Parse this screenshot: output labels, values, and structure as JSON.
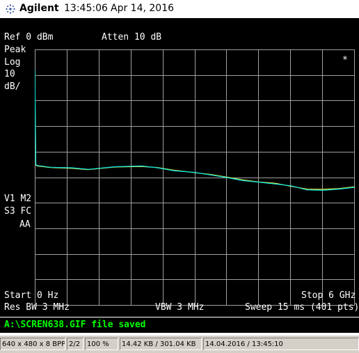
{
  "titlebar": {
    "brand": "Agilent",
    "time": "13:45:06",
    "date": "Apr 14, 2016"
  },
  "analyzer": {
    "ref": "Ref 0 dBm",
    "atten": "Atten 10 dB",
    "side_labels": [
      "Peak",
      "Log",
      "10",
      "dB/"
    ],
    "marker_star": "*",
    "mode_labels": [
      "V1  M2",
      "S3  FC",
      "AA"
    ],
    "start": "Start 0 Hz",
    "stop": "Stop 6 GHz",
    "res_bw": "Res BW 3 MHz",
    "vbw": "VBW 3 MHz",
    "sweep": "Sweep 15 ms (401 pts)"
  },
  "status_message": "A:\\SCREN638.GIF file saved",
  "statusbar": {
    "cells": [
      "640 x 480 x 8 BPP",
      "2/2",
      "100 %",
      "14.42 KB / 301.04 KB",
      "14.04.2016 / 13:45:10"
    ]
  },
  "colors": {
    "trace1": "#00e5e5",
    "trace2": "#e8e840",
    "grid": "#a0a0a0",
    "status_text": "#00ff00"
  },
  "chart_data": {
    "type": "line",
    "x_unit": "GHz",
    "xlim": [
      0,
      6
    ],
    "y_unit": "dBm",
    "ylim": [
      -100,
      0
    ],
    "series": [
      {
        "x": [
          0,
          0.02,
          0.05,
          0.3,
          0.7,
          1.0,
          1.5,
          2.0,
          2.3,
          2.6,
          3.0,
          3.3,
          3.6,
          3.9,
          4.2,
          4.5,
          4.8,
          5.1,
          5.4,
          5.7,
          6.0
        ],
        "values": [
          -8,
          -45,
          -45.3,
          -46,
          -46.2,
          -46.8,
          -45.8,
          -45.5,
          -46.2,
          -47.3,
          -48,
          -49,
          -50,
          -51.2,
          -51.8,
          -52.5,
          -53.2,
          -54.8,
          -55,
          -54.5,
          -53.8
        ]
      },
      {
        "x": [
          0,
          0.02,
          0.05,
          0.3,
          0.7,
          1.0,
          1.5,
          2.0,
          2.3,
          2.6,
          3.0,
          3.3,
          3.6,
          3.9,
          4.2,
          4.5,
          4.8,
          5.1,
          5.4,
          5.7,
          6.0
        ],
        "values": [
          -9,
          -45.2,
          -45.5,
          -46.1,
          -46.4,
          -46.9,
          -45.9,
          -45.7,
          -46.1,
          -47.1,
          -48.1,
          -48.8,
          -49.8,
          -50.9,
          -51.7,
          -52.2,
          -53.4,
          -54.5,
          -54.6,
          -54.3,
          -53.6
        ]
      }
    ]
  }
}
